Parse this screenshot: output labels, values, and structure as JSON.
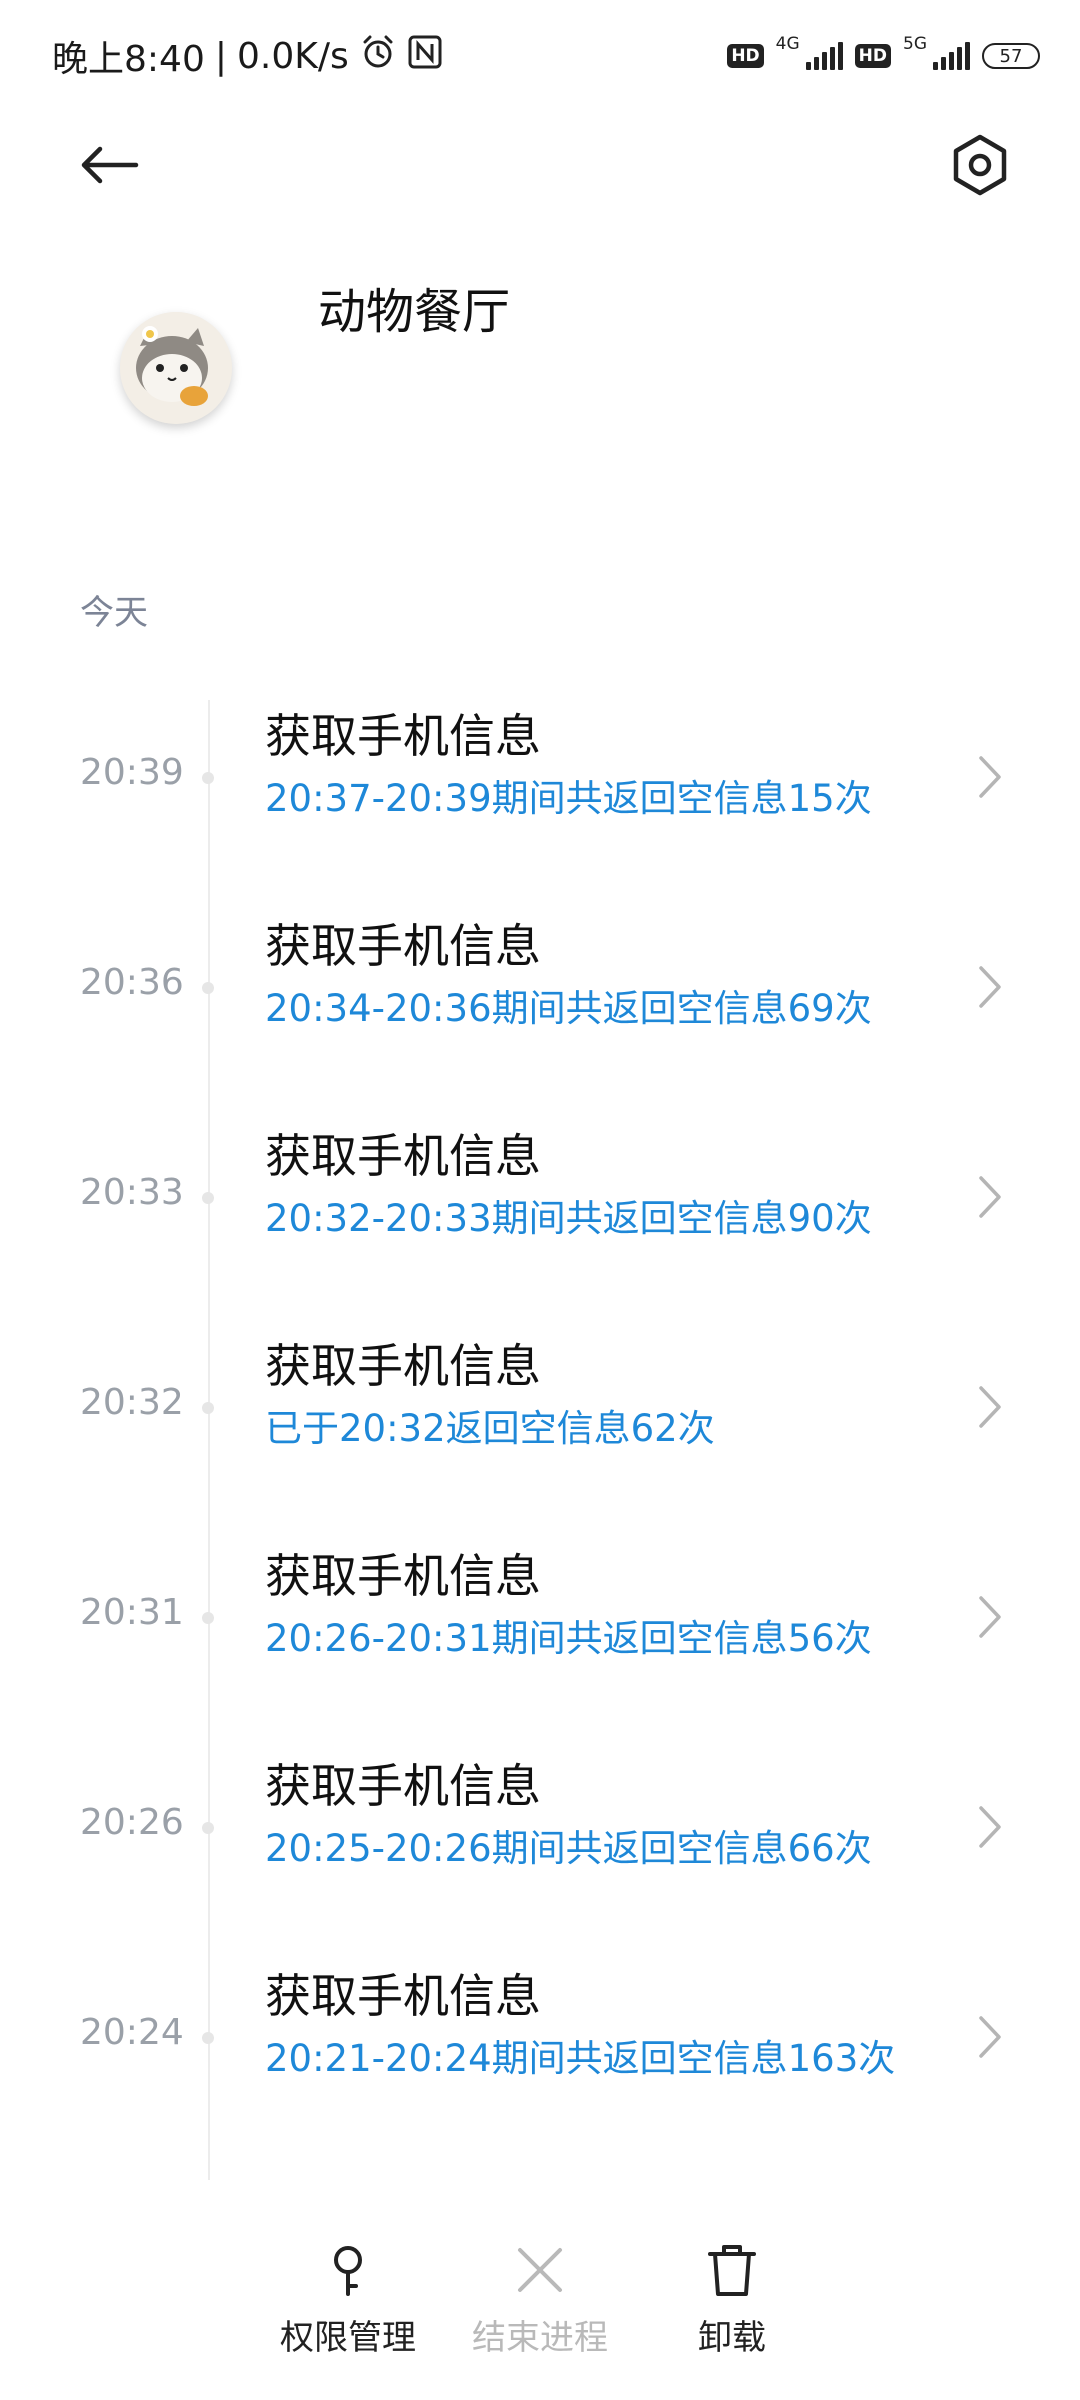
{
  "status_bar": {
    "time": "晚上8:40",
    "separator": "|",
    "speed": "0.0K/s",
    "hd1": "HD",
    "net1": "4G",
    "hd2": "HD",
    "net2": "5G",
    "battery": "57"
  },
  "header": {
    "back_icon": "arrow-left-icon",
    "settings_icon": "settings-icon",
    "app_name": "动物餐厅"
  },
  "section": {
    "label": "今天"
  },
  "entries": [
    {
      "time": "20:39",
      "title": "获取手机信息",
      "detail": "20:37-20:39期间共返回空信息15次"
    },
    {
      "time": "20:36",
      "title": "获取手机信息",
      "detail": "20:34-20:36期间共返回空信息69次"
    },
    {
      "time": "20:33",
      "title": "获取手机信息",
      "detail": "20:32-20:33期间共返回空信息90次"
    },
    {
      "time": "20:32",
      "title": "获取手机信息",
      "detail": "已于20:32返回空信息62次"
    },
    {
      "time": "20:31",
      "title": "获取手机信息",
      "detail": "20:26-20:31期间共返回空信息56次"
    },
    {
      "time": "20:26",
      "title": "获取手机信息",
      "detail": "20:25-20:26期间共返回空信息66次"
    },
    {
      "time": "20:24",
      "title": "获取手机信息",
      "detail": "20:21-20:24期间共返回空信息163次"
    }
  ],
  "bottom_bar": {
    "permissions": {
      "label": "权限管理",
      "icon": "key-icon"
    },
    "end_process": {
      "label": "结束进程",
      "icon": "close-icon"
    },
    "uninstall": {
      "label": "卸载",
      "icon": "trash-icon"
    }
  },
  "colors": {
    "accent": "#1e88d8",
    "time_gray": "#9aa0a8",
    "disabled": "#b9b9b9"
  }
}
